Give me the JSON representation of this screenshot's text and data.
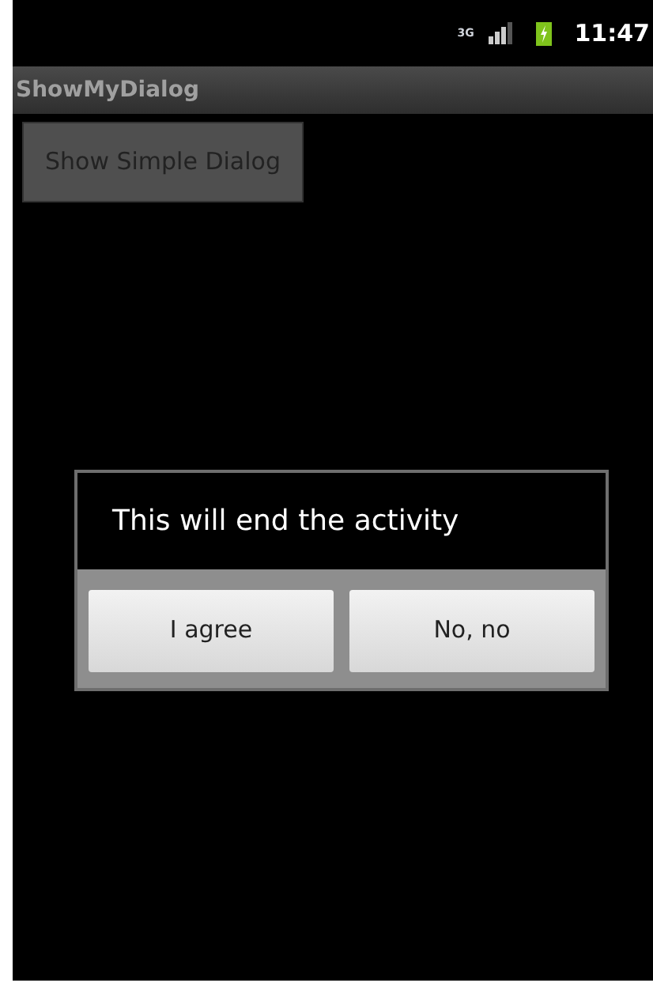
{
  "status_bar": {
    "network": "3G",
    "time": "11:47"
  },
  "title_bar": {
    "title": "ShowMyDialog"
  },
  "button": {
    "label": "Show Simple Dialog"
  },
  "dialog": {
    "message": "This will end the activity",
    "buttons": [
      "I agree",
      "No, no"
    ]
  }
}
